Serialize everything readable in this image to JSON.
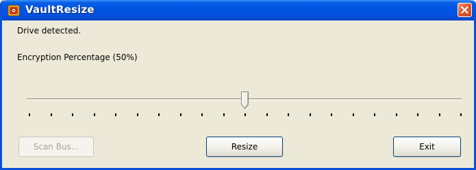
{
  "window": {
    "title": "VaultResize",
    "icon": "vault-app-icon",
    "close_icon": "close-icon"
  },
  "status": {
    "text": "Drive detected."
  },
  "encryption": {
    "label": "Encryption Percentage (50%)",
    "value_percent": 50,
    "tick_count": 21
  },
  "buttons": {
    "scan_bus": {
      "label": "Scan Bus...",
      "enabled": false
    },
    "resize": {
      "label": "Resize",
      "enabled": true
    },
    "exit": {
      "label": "Exit",
      "enabled": true
    }
  },
  "colors": {
    "titlebar": "#0054e3",
    "window_bg": "#ece9d8",
    "close_button": "#e35a2e"
  }
}
